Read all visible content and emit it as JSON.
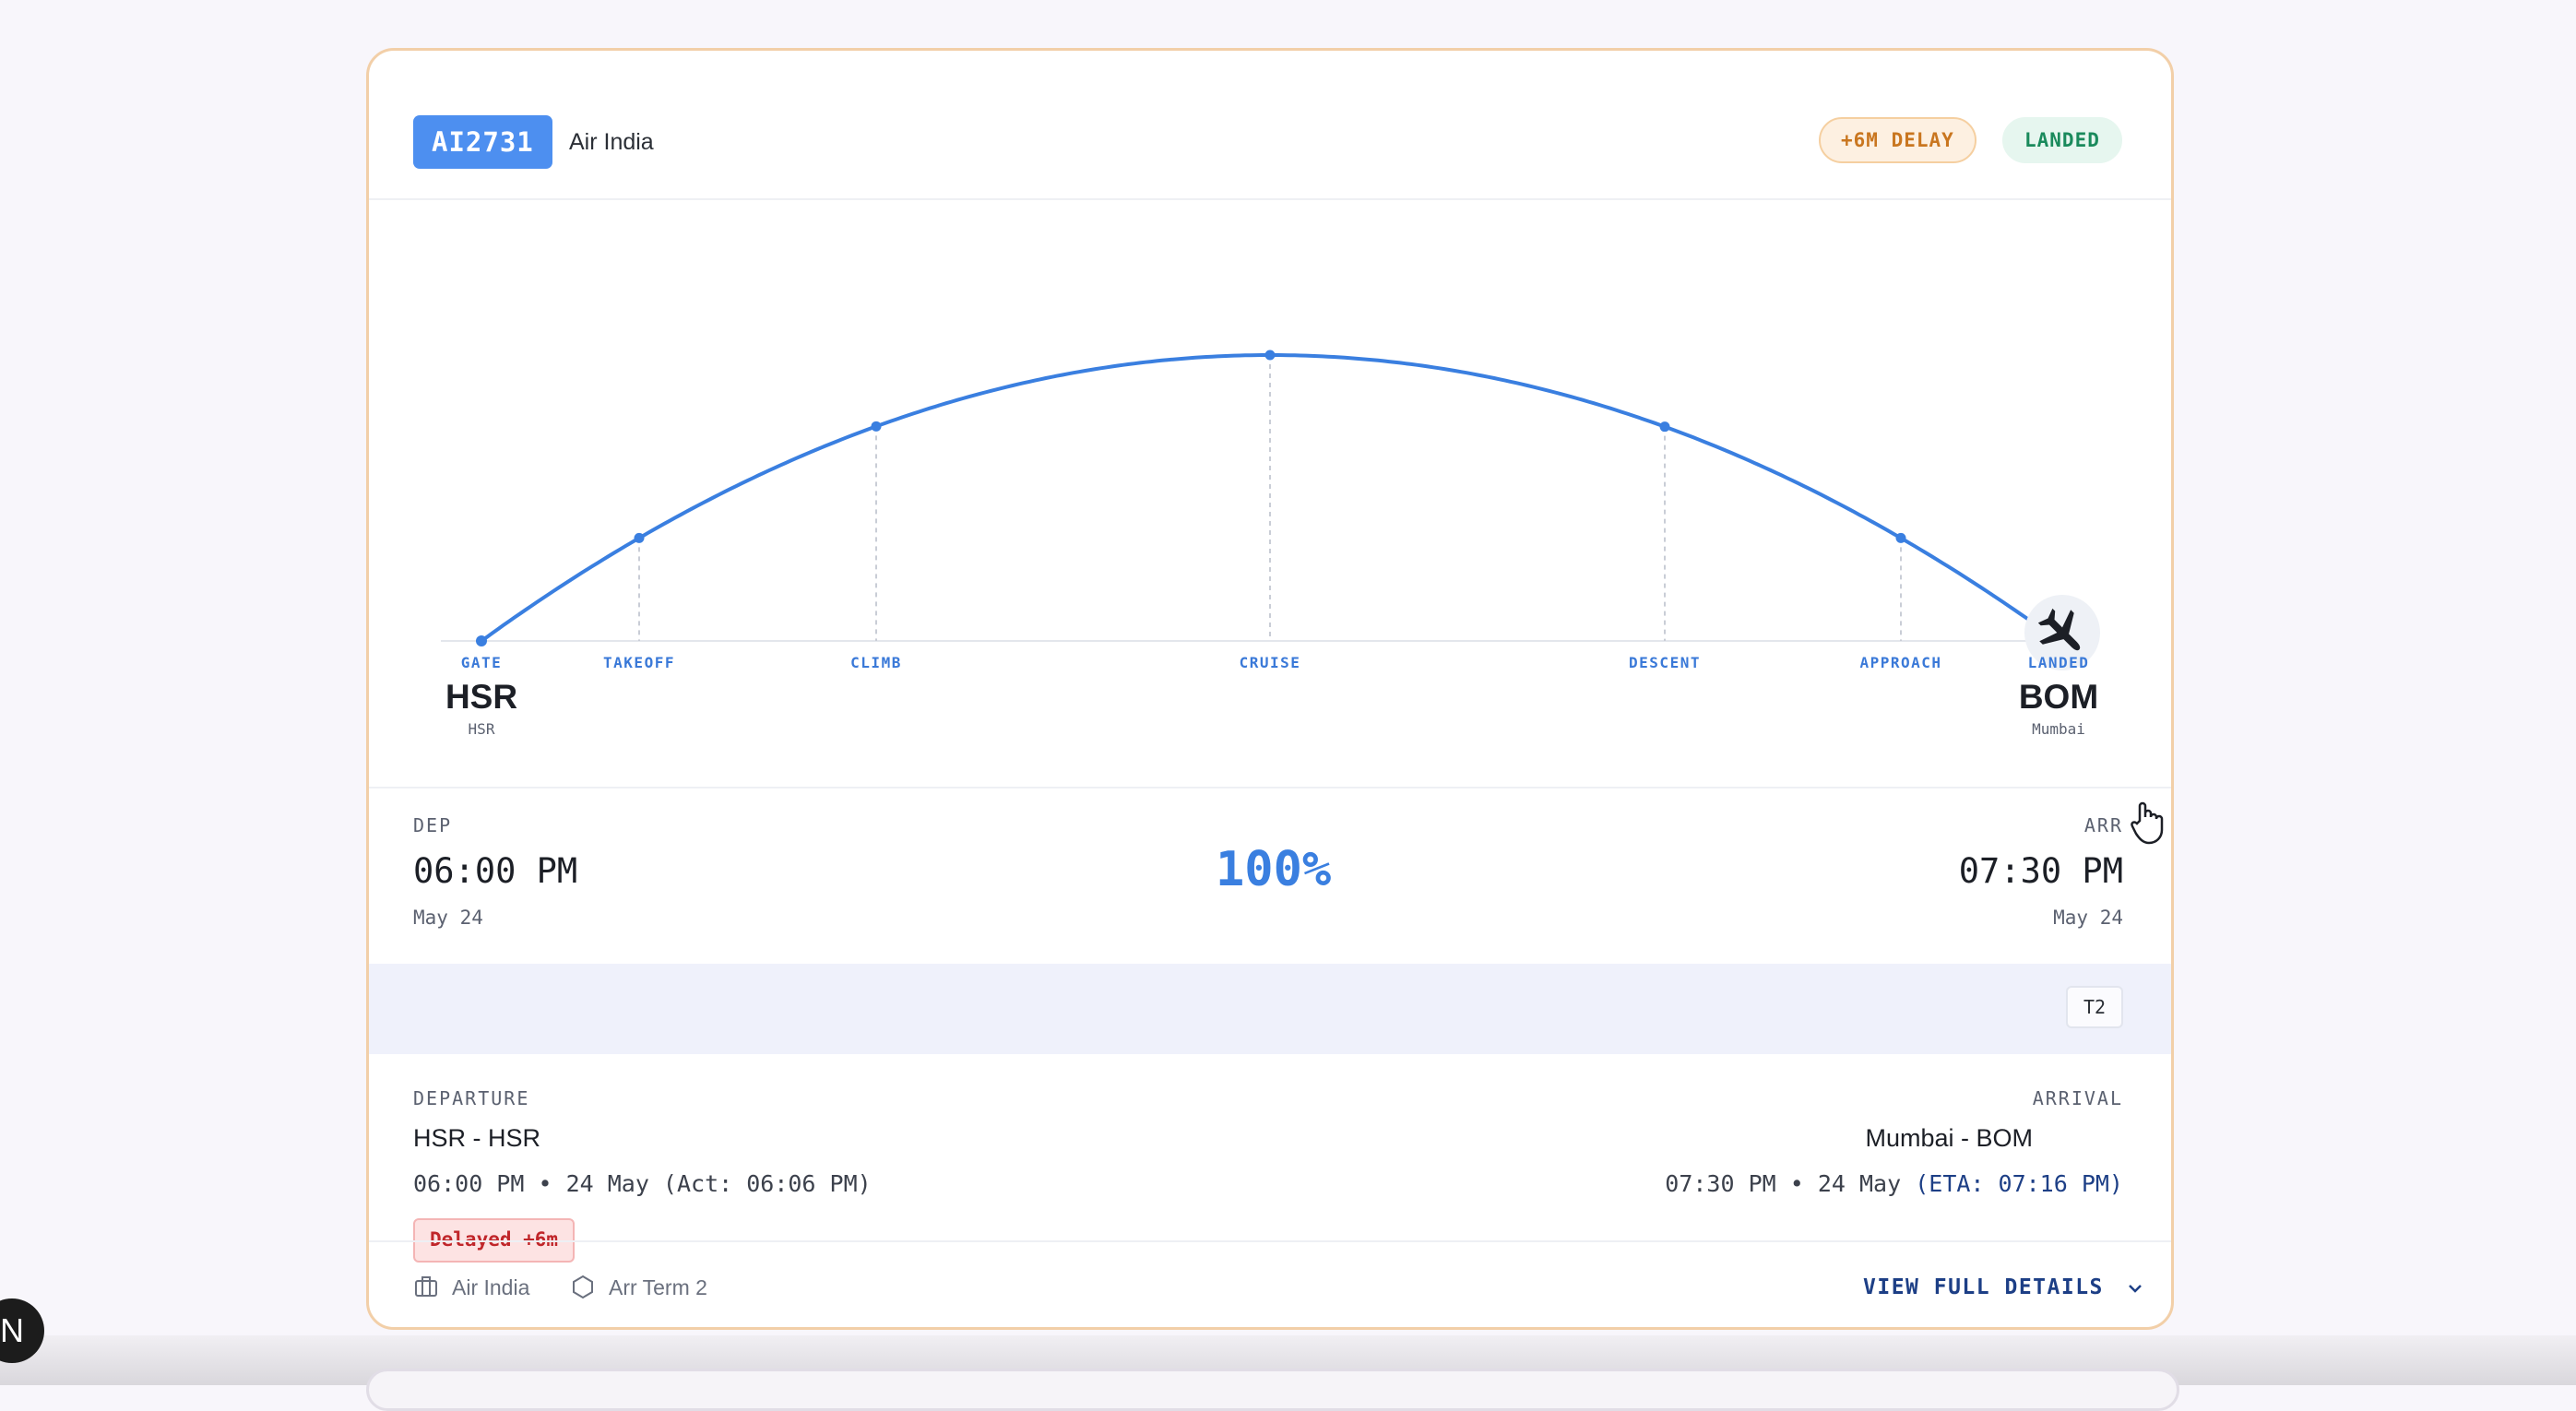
{
  "header": {
    "flight_number": "AI2731",
    "airline": "Air India",
    "delay_badge": "+6M DELAY",
    "status_badge": "LANDED"
  },
  "route_chart": {
    "origin": {
      "code": "HSR",
      "city": "HSR"
    },
    "destination": {
      "code": "BOM",
      "city": "Mumbai"
    },
    "phases": [
      "GATE",
      "TAKEOFF",
      "CLIMB",
      "CRUISE",
      "DESCENT",
      "APPROACH",
      "LANDED"
    ],
    "progress_fraction": 1.0,
    "line_color": "#3a7fe0",
    "plane_icon": "airplane-icon"
  },
  "times": {
    "dep_label": "DEP",
    "dep_time": "06:00 PM",
    "dep_date": "May 24",
    "progress_text": "100%",
    "arr_label": "ARR",
    "arr_time": "07:30 PM",
    "arr_date": "May 24"
  },
  "terminal": {
    "chip": "T2"
  },
  "details": {
    "departure_label": "DEPARTURE",
    "departure_route": "HSR - HSR",
    "departure_time": "06:00 PM • 24 May (Act: 06:06 PM)",
    "delay_tag": "Delayed +6m",
    "arrival_label": "ARRIVAL",
    "arrival_route": "Mumbai - BOM",
    "arrival_time": "07:30 PM • 24 May ",
    "arrival_eta": "(ETA: 07:16 PM)"
  },
  "footer": {
    "airline": "Air India",
    "terminal": "Arr Term 2",
    "view_details": "VIEW FULL DETAILS"
  },
  "overlay": {
    "badge_letter": "N"
  }
}
